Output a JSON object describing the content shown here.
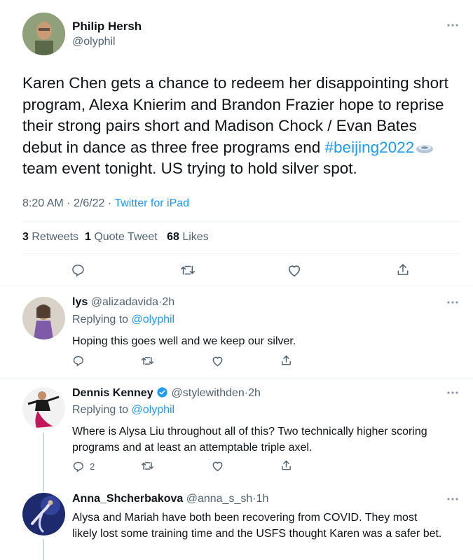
{
  "main_tweet": {
    "author_name": "Philip Hersh",
    "author_handle": "@olyphil",
    "text_before_hashtag": "Karen Chen gets a chance to redeem her disappointing short program, Alexa Knierim and Brandon Frazier hope to reprise their strong pairs short and Madison Chock / Evan Bates debut in dance as three free programs end ",
    "hashtag": "#beijing2022",
    "text_after_hashtag": " team event tonight.  US trying to hold silver spot.",
    "time": "8:20 AM",
    "date": "2/6/22",
    "source": "Twitter for iPad",
    "retweets_count": "3",
    "retweets_label": "Retweets",
    "quotes_count": "1",
    "quotes_label": "Quote Tweet",
    "likes_count": "68",
    "likes_label": "Likes"
  },
  "replies": [
    {
      "name": "lys",
      "handle": "@alizadavida",
      "time": "2h",
      "replying_prefix": "Replying to",
      "replying_to": "@olyphil",
      "text": "Hoping this goes well and we keep our silver.",
      "reply_count": ""
    },
    {
      "name": "Dennis Kenney",
      "handle": "@stylewithden",
      "time": "2h",
      "replying_prefix": "Replying to",
      "replying_to": "@olyphil",
      "text": "Where is Alysa Liu throughout all of this? Two technically higher scoring programs and at least an attemptable triple axel.",
      "reply_count": "2"
    },
    {
      "name": "Anna_Shcherbakova",
      "handle": "@anna_s_sh",
      "time": "1h",
      "text": "Alysa and Mariah have both been recovering from COVID. They most likely lost some training time and the USFS thought Karen was a safer bet."
    }
  ],
  "colors": {
    "link": "#1d9bf0",
    "muted": "#536471",
    "verified": "#1d9bf0"
  },
  "icons": [
    "more-icon",
    "reply-icon",
    "retweet-icon",
    "like-icon",
    "share-icon",
    "verified-icon",
    "olympic-emoji-icon"
  ],
  "separator": "·"
}
